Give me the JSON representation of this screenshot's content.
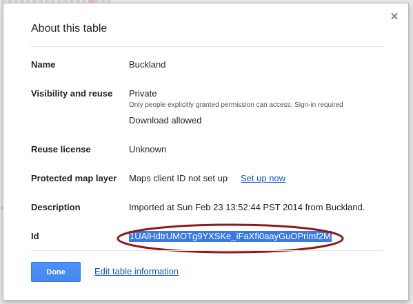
{
  "dialog": {
    "title": "About this table",
    "close_symbol": "×"
  },
  "rows": {
    "name": {
      "label": "Name",
      "value": "Buckland"
    },
    "visibility": {
      "label": "Visibility and reuse",
      "value": "Private",
      "subtext": "Only people explicitly granted permission can access. Sign-in required",
      "download": "Download allowed"
    },
    "license": {
      "label": "Reuse license",
      "value": "Unknown"
    },
    "map_layer": {
      "label": "Protected map layer",
      "value": "Maps client ID not set up",
      "link": "Set up now"
    },
    "description": {
      "label": "Description",
      "value": "Imported at Sun Feb 23 13:52:44 PST 2014 from Buckland."
    },
    "id": {
      "label": "Id",
      "value": "1UAlHdtrUMOTg9YXSKe_iFaXfi0aayGuOPrimf2M"
    }
  },
  "footer": {
    "done_label": "Done",
    "edit_link": "Edit table information"
  },
  "colors": {
    "primary_button": "#4d90fe",
    "link": "#1155cc",
    "selection": "#3a78e6",
    "annotation_circle": "#8b1a1a"
  },
  "icons": {
    "close": "close-icon"
  }
}
